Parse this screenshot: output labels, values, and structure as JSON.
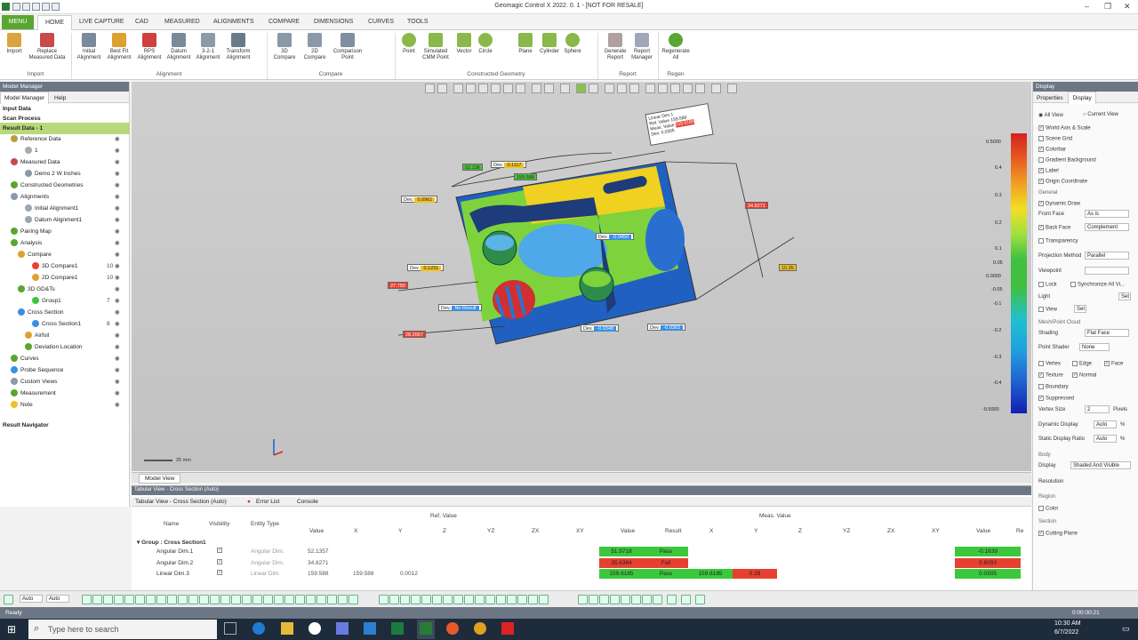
{
  "window": {
    "title": "Geomagic Control X 2022. 0. 1 - [NOT FOR RESALE]"
  },
  "menu": {
    "menu_btn": "MENU",
    "tabs": [
      "HOME",
      "LIVE CAPTURE",
      "CAD",
      "MEASURED",
      "ALIGNMENTS",
      "COMPARE",
      "DIMENSIONS",
      "CURVES",
      "TOOLS"
    ]
  },
  "ribbon": {
    "buttons": [
      {
        "label": "Import",
        "icon": "import-icon"
      },
      {
        "label": "Replace Measured Data",
        "icon": "replace-icon"
      },
      {
        "label": "Initial Alignment",
        "icon": "initial-alignment-icon"
      },
      {
        "label": "Best Fit Alignment",
        "icon": "best-fit-icon"
      },
      {
        "label": "RPS Alignment",
        "icon": "rps-icon"
      },
      {
        "label": "Datum Alignment",
        "icon": "datum-icon"
      },
      {
        "label": "3-2-1 Alignment",
        "icon": "321-icon"
      },
      {
        "label": "Transform Alignment",
        "icon": "transform-icon"
      },
      {
        "label": "3D Compare",
        "icon": "3d-compare-icon"
      },
      {
        "label": "2D Compare",
        "icon": "2d-compare-icon"
      },
      {
        "label": "Comparison Point",
        "icon": "comparison-point-icon"
      },
      {
        "label": "Point",
        "icon": "point-icon"
      },
      {
        "label": "Simulated CMM Point",
        "icon": "cmm-point-icon"
      },
      {
        "label": "Vector",
        "icon": "vector-icon"
      },
      {
        "label": "Circle",
        "icon": "circle-icon"
      },
      {
        "label": "Plane",
        "icon": "plane-icon"
      },
      {
        "label": "Cylinder",
        "icon": "cylinder-icon"
      },
      {
        "label": "Sphere",
        "icon": "sphere-icon"
      },
      {
        "label": "Generate Report",
        "icon": "generate-report-icon"
      },
      {
        "label": "Report Manager",
        "icon": "report-manager-icon"
      },
      {
        "label": "Regenerate All",
        "icon": "regenerate-icon"
      }
    ],
    "groups": [
      "Import",
      "Alignment",
      "Compare",
      "Constructed Geometry",
      "Report",
      "Regen"
    ]
  },
  "model_manager": {
    "title": "Model Manager",
    "tabs": [
      "Model Manager",
      "Help"
    ],
    "sections": [
      "Input Data",
      "Scan Process",
      "Result Data - 1"
    ],
    "tree": [
      {
        "label": "Reference Data",
        "indent": 1
      },
      {
        "label": "1",
        "indent": 3
      },
      {
        "label": "Measured Data",
        "indent": 1
      },
      {
        "label": "Demo 2 W Inches",
        "indent": 3
      },
      {
        "label": "Constructed Geometries",
        "indent": 1
      },
      {
        "label": "Alignments",
        "indent": 1
      },
      {
        "label": "Initial Alignment1",
        "indent": 3
      },
      {
        "label": "Datum Alignment1",
        "indent": 3
      },
      {
        "label": "Pairing Map",
        "indent": 1
      },
      {
        "label": "Analysis",
        "indent": 1
      },
      {
        "label": "Compare",
        "indent": 2
      },
      {
        "label": "3D Compare1",
        "indent": 4,
        "count": "10"
      },
      {
        "label": "2D Compare1",
        "indent": 4,
        "count": "10"
      },
      {
        "label": "3D GD&Ts",
        "indent": 2
      },
      {
        "label": "Group1",
        "indent": 4,
        "count": "7"
      },
      {
        "label": "Cross Section",
        "indent": 2
      },
      {
        "label": "Cross Section1",
        "indent": 4,
        "count": "8"
      },
      {
        "label": "Airfoil",
        "indent": 3
      },
      {
        "label": "Deviation Location",
        "indent": 3
      },
      {
        "label": "Curves",
        "indent": 1
      },
      {
        "label": "Probe Sequence",
        "indent": 1
      },
      {
        "label": "Custom Views",
        "indent": 1
      },
      {
        "label": "Measurement",
        "indent": 1
      },
      {
        "label": "Note",
        "indent": 1
      }
    ],
    "result_navigator": "Result Navigator"
  },
  "viewport": {
    "tab": "Model View",
    "scale_label": "25 mm",
    "colorbar": {
      "max": "0.5000",
      "mid": "0.0000",
      "min": "-0.5000",
      "ticks": [
        "0.4",
        "0.3",
        "0.2",
        "0.1",
        "0.05",
        "0.0000",
        "-0.05",
        "-0.1",
        "-0.2",
        "-0.3",
        "-0.4"
      ]
    },
    "annotations": [
      {
        "text": "Dev.",
        "value": "0.1117",
        "color": "#f0c020"
      },
      {
        "text": "Dev.",
        "value": "0.0961",
        "color": "#f0c020"
      },
      {
        "text": "Dev.",
        "value": "0.1231",
        "color": "#f0c020"
      },
      {
        "text": "Dev.",
        "value": "No Result",
        "color": "#3a90e0"
      },
      {
        "text": "Dev.",
        "value": "-0.0450",
        "color": "#3a90e0"
      },
      {
        "text": "Dev.",
        "value": "-0.0348",
        "color": "#3a90e0"
      },
      {
        "text": "Dev.",
        "value": "-0.0363",
        "color": "#3a90e0"
      }
    ],
    "dims": [
      "52.136",
      "159.588",
      "27.750",
      "28.2667",
      "34.8271",
      "10.35"
    ],
    "popup": {
      "title": "Linear Dim.1",
      "rows": [
        [
          "Ref. Value",
          "159.588"
        ],
        [
          "Meas. Value",
          "159.6185"
        ],
        [
          "Dev.",
          "0.0305"
        ]
      ]
    }
  },
  "display_panel": {
    "title": "Display",
    "tabs": [
      "Properties",
      "Display"
    ],
    "view_radio": [
      "All View",
      "Current View"
    ],
    "checks": [
      {
        "label": "World Axis & Scale",
        "checked": true
      },
      {
        "label": "Scene Grid",
        "checked": false
      },
      {
        "label": "Colorbar",
        "checked": true
      },
      {
        "label": "Gradient Background",
        "checked": false
      },
      {
        "label": "Label",
        "checked": true
      },
      {
        "label": "Origin Coordinate",
        "checked": true
      }
    ],
    "general": "General",
    "dynamic_draw": "Dynamic Draw",
    "front_face": {
      "label": "Front Face",
      "value": "As is"
    },
    "back_face": {
      "label": "Back Face",
      "value": "Complement"
    },
    "transparency": "Transparency",
    "projection": {
      "label": "Projection Method",
      "value": "Parallel"
    },
    "viewpoint": "Viewpoint",
    "lock": "Lock",
    "synchronize": "Synchronize All Vi...",
    "light": "Light",
    "light_set": "Set",
    "view": "View",
    "view_set": "Set",
    "mesh_section": "Mesh/Point Cloud",
    "shading": {
      "label": "Shading",
      "value": "Flat Face"
    },
    "point_shader": {
      "label": "Point Shader",
      "value": "None"
    },
    "vertex": "Vertex",
    "edge": "Edge",
    "face": "Face",
    "texture": "Texture",
    "normal": "Normal",
    "boundary": "Boundary",
    "suppressed": "Suppressed",
    "vertex_size": {
      "label": "Vertex Size",
      "value": "2",
      "unit": "Pixels"
    },
    "dynamic_display": {
      "label": "Dynamic Display",
      "value": "Auto",
      "unit": "%"
    },
    "static_ratio": {
      "label": "Static Display Ratio",
      "value": "Auto",
      "unit": "%"
    },
    "body": "Body",
    "display": {
      "label": "Display",
      "value": "Shaded And Visible"
    },
    "resolution": "Resolution",
    "region": "Region",
    "color": "Color",
    "section": "Section",
    "cutting_plane": "Cutting Plane"
  },
  "tabular": {
    "title": "Tabular View - Cross Section (Auto)",
    "tabs": [
      "Tabular View - Cross Section (Auto)",
      "Error List",
      "Console"
    ],
    "headers": {
      "name": "Name",
      "visibility": "Visibility",
      "entity_type": "Entity Type",
      "ref_value": "Ref. Value",
      "meas_value": "Meas. Value"
    },
    "subheaders": [
      "Value",
      "X",
      "Y",
      "Z",
      "YZ",
      "ZX",
      "XY",
      "Value",
      "Result",
      "X",
      "Y",
      "Z",
      "YZ",
      "ZX",
      "XY",
      "Value",
      "Re"
    ],
    "group": "Group : Cross Section1",
    "rows": [
      {
        "name": "Angular Dim.1",
        "type": "Angular Dim.",
        "ref": "52.1357",
        "refx": "",
        "refy": "",
        "meas": "51.9718",
        "result": "Pass",
        "mx": "",
        "my": "",
        "dev": "-0.1639",
        "status": "pass"
      },
      {
        "name": "Angular Dim.2",
        "type": "Angular Dim.",
        "ref": "34.8271",
        "refx": "",
        "refy": "",
        "meas": "35.6364",
        "result": "Fail",
        "mx": "",
        "my": "",
        "dev": "0.8093",
        "status": "fail"
      },
      {
        "name": "Linear Dim.3",
        "type": "Linear Dim.",
        "ref": "159.588",
        "refx": "159.588",
        "refy": "0.0012",
        "meas": "159.6185",
        "result": "Pass",
        "mx": "159.6185",
        "my": "0.28",
        "dev": "0.0305",
        "status": "pass"
      }
    ]
  },
  "bottom_toolbar": {
    "auto1": "Auto",
    "auto2": "Auto"
  },
  "status": {
    "text": "Ready",
    "timer": "0:00:00:21"
  },
  "taskbar": {
    "search_placeholder": "Type here to search",
    "time": "10:30 AM",
    "date": "6/7/2022"
  },
  "colors": {
    "menu_green": "#5aa632",
    "pass": "#3cc83c",
    "fail": "#e84030",
    "header": "#6c7684"
  }
}
